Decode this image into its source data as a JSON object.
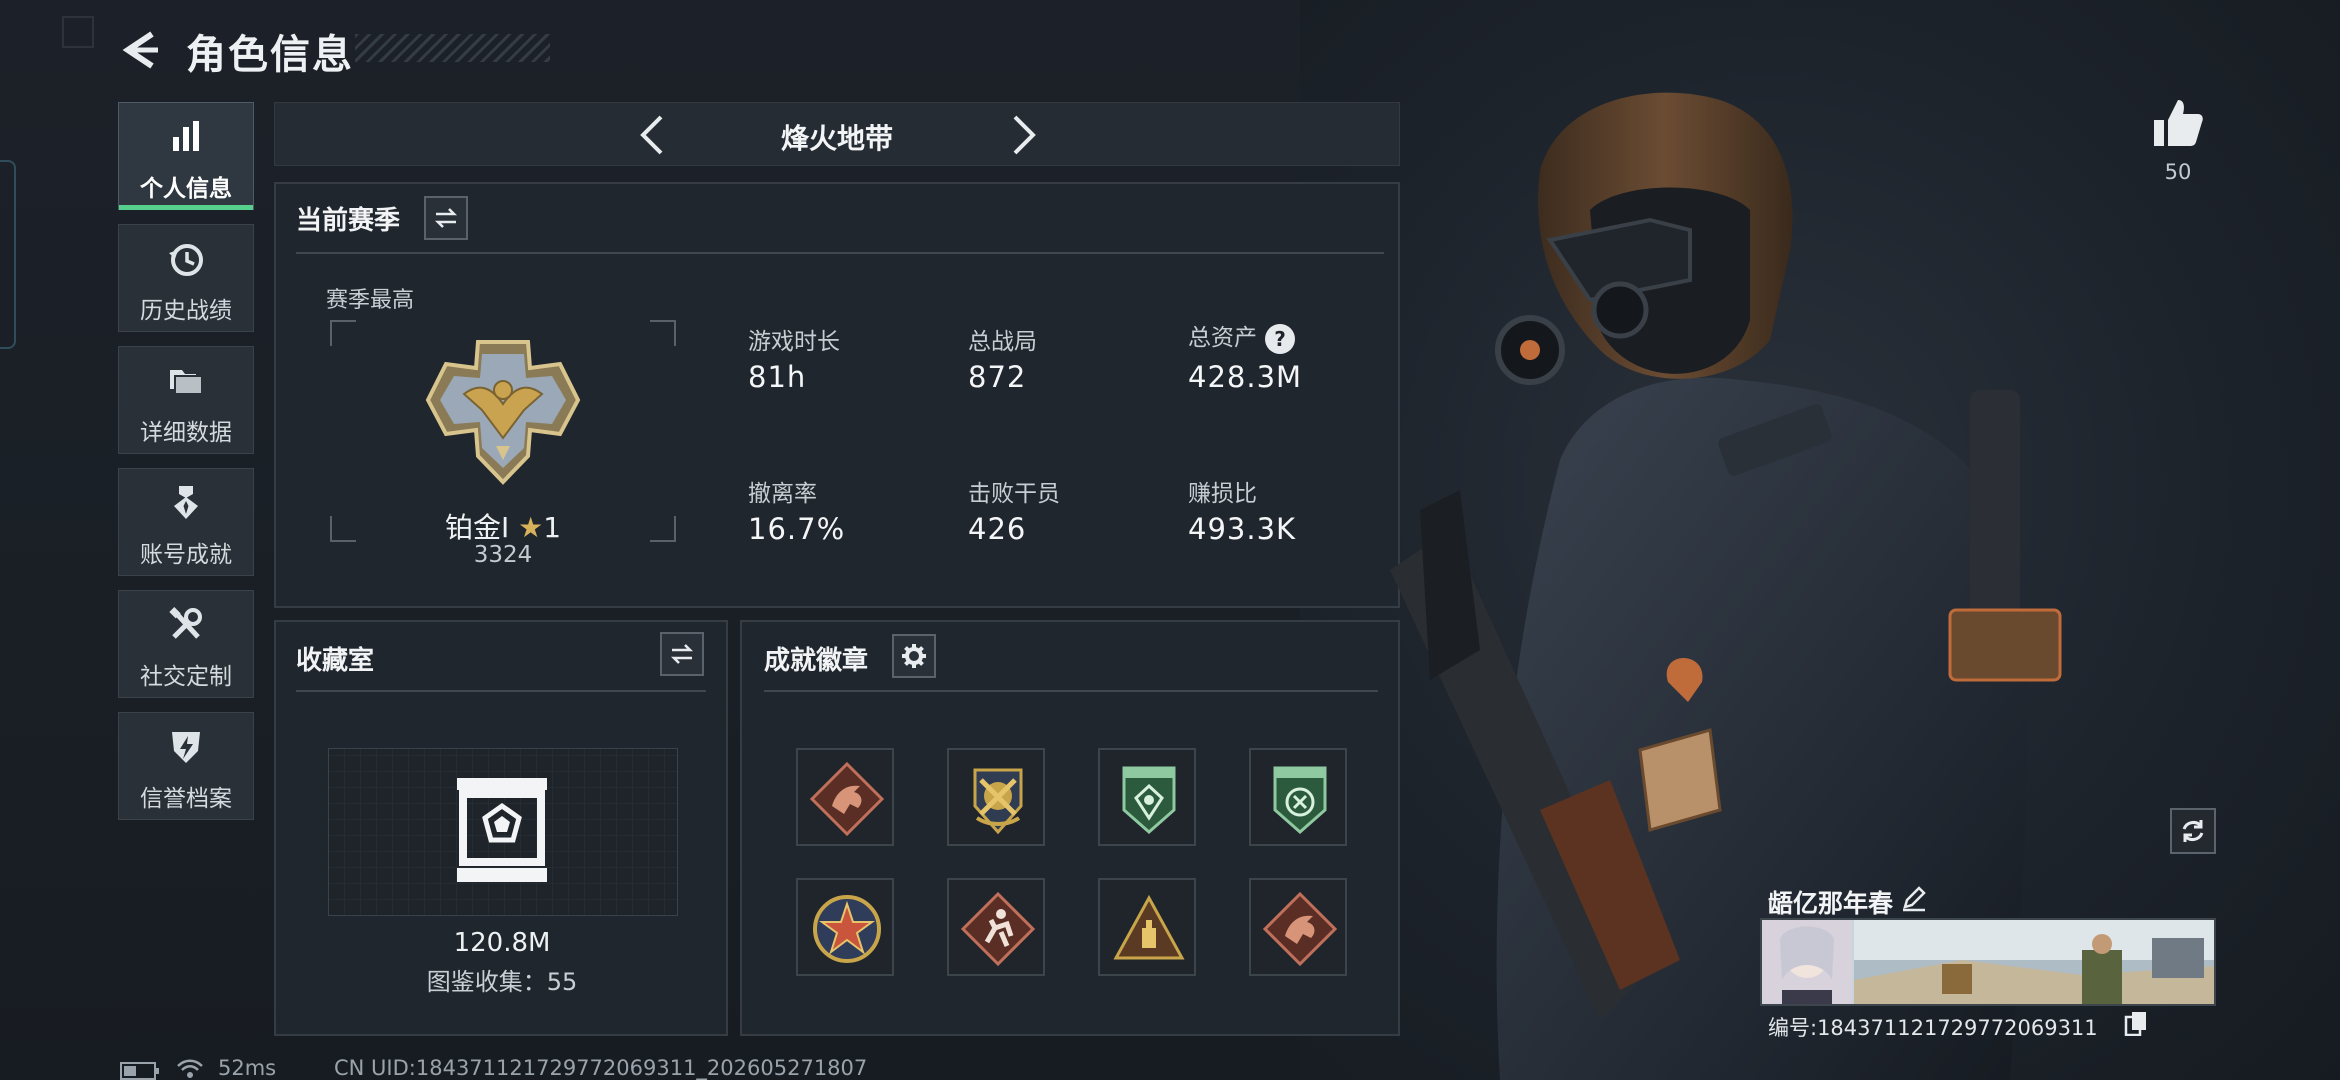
{
  "header": {
    "title": "角色信息"
  },
  "sidebar": {
    "items": [
      {
        "label": "个人信息",
        "active": true,
        "icon": "bar-chart-icon"
      },
      {
        "label": "历史战绩",
        "icon": "history-clock-icon"
      },
      {
        "label": "详细数据",
        "icon": "folder-icon"
      },
      {
        "label": "账号成就",
        "icon": "medal-icon"
      },
      {
        "label": "社交定制",
        "icon": "tools-icon"
      },
      {
        "label": "信誉档案",
        "icon": "shield-lightning-icon"
      }
    ]
  },
  "mode_selector": {
    "current": "烽火地带"
  },
  "season_panel": {
    "title": "当前赛季",
    "subtitle": "赛季最高",
    "rank_name": "铂金I",
    "rank_stars": "1",
    "rank_score": "3324",
    "stats": [
      {
        "label": "游戏时长",
        "value": "81h"
      },
      {
        "label": "总战局",
        "value": "872"
      },
      {
        "label": "总资产",
        "value": "428.3M"
      },
      {
        "label": "撤离率",
        "value": "16.7%"
      },
      {
        "label": "击败干员",
        "value": "426"
      },
      {
        "label": "赚损比",
        "value": "493.3K"
      }
    ]
  },
  "collection_panel": {
    "title": "收藏室",
    "value": "120.8M",
    "count_text": "图鉴收集：55"
  },
  "badges_panel": {
    "title": "成就徽章",
    "badges": [
      {
        "icon": "dragon-emblem-icon",
        "color": "#c0705a"
      },
      {
        "icon": "crossed-swords-emblem-icon",
        "color": "#c9a54a"
      },
      {
        "icon": "green-shield-emblem-icon",
        "color": "#4f9a68"
      },
      {
        "icon": "green-shield-emblem-icon",
        "color": "#4f9a68"
      },
      {
        "icon": "star-seal-emblem-icon",
        "color": "#c9553d"
      },
      {
        "icon": "runner-emblem-icon",
        "color": "#c0705a"
      },
      {
        "icon": "triangle-emblem-icon",
        "color": "#c9a54a"
      },
      {
        "icon": "dragon-emblem-icon",
        "color": "#c0705a"
      }
    ]
  },
  "profile": {
    "likes": "50",
    "player_name": "龉亿那年春",
    "player_id": "编号:184371121729772069311"
  },
  "status_bar": {
    "ping": "52ms",
    "uid": "CN UID:184371121729772069311_202605271807"
  },
  "colors": {
    "accent_green": "#57d08e",
    "panel_bg": "#20262d",
    "page_bg": "#1a1f26"
  }
}
